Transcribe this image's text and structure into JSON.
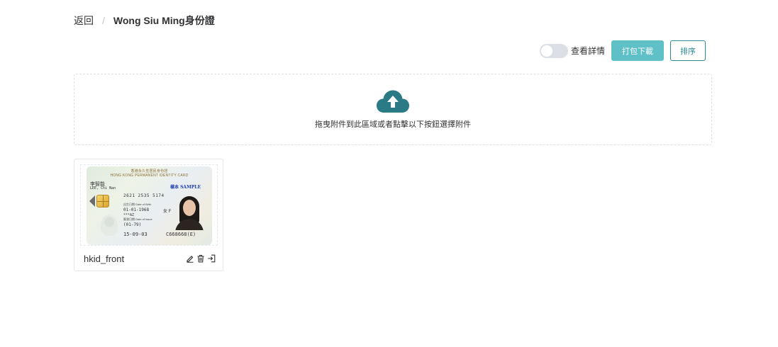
{
  "breadcrumb": {
    "back_label": "返回",
    "separator": "/",
    "current": "Wong Siu Ming身份證"
  },
  "toolbar": {
    "toggle_label": "查看詳情",
    "toggle_on": false,
    "download_label": "打包下載",
    "sort_label": "排序",
    "primary_color": "#5fc0c8",
    "outline_color": "#2a8a96"
  },
  "upload": {
    "icon": "cloud-upload-icon",
    "icon_color": "#2a7b86",
    "hint": "拖曳附件到此區域或者點擊以下按鈕選擇附件"
  },
  "files": [
    {
      "name": "hkid_front",
      "actions": [
        "edit-icon",
        "delete-icon",
        "export-icon"
      ],
      "preview": {
        "header_cn": "香港永久性居民身份證",
        "header_en": "HONG KONG PERMANENT IDENTITY CARD",
        "name_cn": "李智能",
        "name_en": "LEE, Chi Nan",
        "code_number": "2621 2535 5174",
        "sample": "樣本 SAMPLE",
        "dob_label": "出生日期 Date of Birth",
        "dob": "01-01-1968",
        "sex": "女 F",
        "stars": "***AZ",
        "issue_label": "簽發日期 Date of Issue",
        "issue": "(01-79)",
        "expiry": "15-09-03",
        "id_number": "C668668(E)"
      }
    }
  ]
}
